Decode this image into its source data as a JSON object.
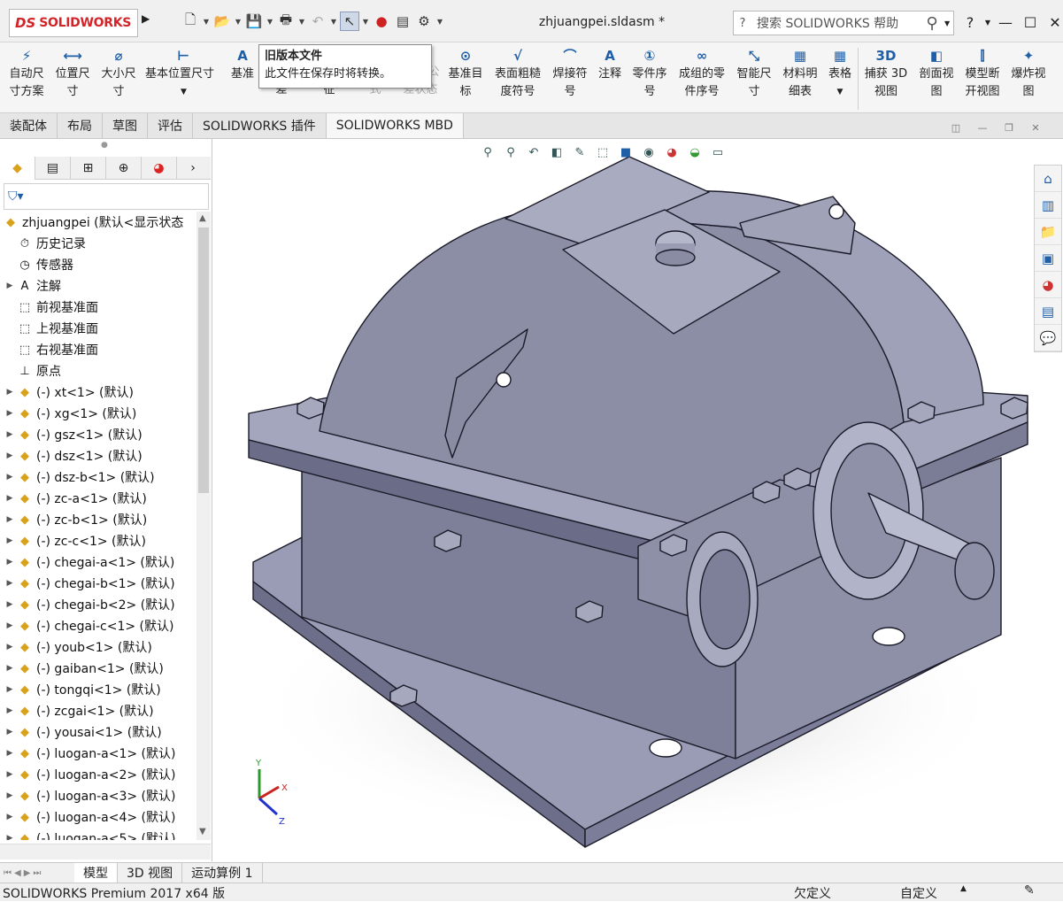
{
  "app": {
    "logo_ds": "DS",
    "logo_text": "SOLIDWORKS",
    "document_title": "zhjuangpei.sldasm *"
  },
  "search": {
    "label": "搜索 SOLIDWORKS 帮助"
  },
  "window": {
    "help": "?",
    "minimize": "—",
    "maximize": "☐",
    "close": "✕"
  },
  "ribbon": {
    "items": [
      {
        "line1": "自动尺",
        "line2": "寸方案"
      },
      {
        "line1": "位置尺",
        "line2": "寸"
      },
      {
        "line1": "大小尺",
        "line2": "寸"
      },
      {
        "line1": "基本位置尺寸",
        "line2": ""
      },
      {
        "line1": "基准",
        "line2": ""
      },
      {
        "line1": "",
        "line2": "差"
      },
      {
        "line1": "",
        "line2": "征"
      },
      {
        "line1": "",
        "line2": "式"
      },
      {
        "line1": "公",
        "line2": "差状态"
      },
      {
        "line1": "基准目",
        "line2": "标"
      },
      {
        "line1": "表面粗糙",
        "line2": "度符号"
      },
      {
        "line1": "焊接符",
        "line2": "号"
      },
      {
        "line1": "注释",
        "line2": ""
      },
      {
        "line1": "零件序",
        "line2": "号"
      },
      {
        "line1": "成组的零",
        "line2": "件序号"
      },
      {
        "line1": "智能尺",
        "line2": "寸"
      },
      {
        "line1": "材料明",
        "line2": "细表"
      },
      {
        "line1": "表格",
        "line2": ""
      },
      {
        "line1": "捕获 3D",
        "line2": "视图"
      },
      {
        "line1": "剖面视",
        "line2": "图"
      },
      {
        "line1": "模型断",
        "line2": "开视图"
      },
      {
        "line1": "爆炸视",
        "line2": "图"
      }
    ]
  },
  "tooltip": {
    "title": "旧版本文件",
    "text": "此文件在保存时将转换。"
  },
  "tabs": [
    "装配体",
    "布局",
    "草图",
    "评估",
    "SOLIDWORKS 插件",
    "SOLIDWORKS MBD"
  ],
  "tree": {
    "root": "zhjuangpei (默认<显示状态",
    "items": [
      {
        "label": "历史记录",
        "icon": "history-icon",
        "arrow": false
      },
      {
        "label": "传感器",
        "icon": "sensor-icon",
        "arrow": false
      },
      {
        "label": "注解",
        "icon": "annotation-icon",
        "arrow": true
      },
      {
        "label": "前视基准面",
        "icon": "plane-icon",
        "arrow": false
      },
      {
        "label": "上视基准面",
        "icon": "plane-icon",
        "arrow": false
      },
      {
        "label": "右视基准面",
        "icon": "plane-icon",
        "arrow": false
      },
      {
        "label": "原点",
        "icon": "origin-icon",
        "arrow": false
      },
      {
        "label": "(-) xt<1> (默认)",
        "icon": "part-icon",
        "arrow": true
      },
      {
        "label": "(-) xg<1> (默认)",
        "icon": "part-icon",
        "arrow": true
      },
      {
        "label": "(-) gsz<1> (默认)",
        "icon": "part-icon",
        "arrow": true
      },
      {
        "label": "(-) dsz<1> (默认)",
        "icon": "part-icon",
        "arrow": true
      },
      {
        "label": "(-) dsz-b<1> (默认)",
        "icon": "part-icon",
        "arrow": true
      },
      {
        "label": "(-) zc-a<1> (默认)",
        "icon": "part-icon",
        "arrow": true
      },
      {
        "label": "(-) zc-b<1> (默认)",
        "icon": "part-icon",
        "arrow": true
      },
      {
        "label": "(-) zc-c<1> (默认)",
        "icon": "part-icon",
        "arrow": true
      },
      {
        "label": "(-) chegai-a<1> (默认)",
        "icon": "part-icon",
        "arrow": true
      },
      {
        "label": "(-) chegai-b<1> (默认)",
        "icon": "part-icon",
        "arrow": true
      },
      {
        "label": "(-) chegai-b<2> (默认)",
        "icon": "part-icon",
        "arrow": true
      },
      {
        "label": "(-) chegai-c<1> (默认)",
        "icon": "part-icon",
        "arrow": true
      },
      {
        "label": "(-) youb<1> (默认)",
        "icon": "part-icon",
        "arrow": true
      },
      {
        "label": "(-) gaiban<1> (默认)",
        "icon": "part-icon",
        "arrow": true
      },
      {
        "label": "(-) tongqi<1> (默认)",
        "icon": "part-icon",
        "arrow": true
      },
      {
        "label": "(-) zcgai<1> (默认)",
        "icon": "part-icon",
        "arrow": true
      },
      {
        "label": "(-) yousai<1> (默认)",
        "icon": "part-icon",
        "arrow": true
      },
      {
        "label": "(-) luogan-a<1> (默认)",
        "icon": "part-icon",
        "arrow": true
      },
      {
        "label": "(-) luogan-a<2> (默认)",
        "icon": "part-icon",
        "arrow": true
      },
      {
        "label": "(-) luogan-a<3> (默认)",
        "icon": "part-icon",
        "arrow": true
      },
      {
        "label": "(-) luogan-a<4> (默认)",
        "icon": "part-icon",
        "arrow": true
      },
      {
        "label": "(-) luogan-a<5> (默认)",
        "icon": "part-icon",
        "arrow": true
      }
    ]
  },
  "bottom_tabs": [
    "模型",
    "3D 视图",
    "运动算例 1"
  ],
  "status": {
    "product": "SOLIDWORKS Premium 2017 x64 版",
    "under_defined": "欠定义",
    "custom": "自定义"
  },
  "triad": {
    "x": "X",
    "y": "Y",
    "z": "Z"
  },
  "colors": {
    "model": "#8e90a8",
    "model_dark": "#5d5f78",
    "accent": "#1f5fa8",
    "brand": "#d2252a"
  }
}
